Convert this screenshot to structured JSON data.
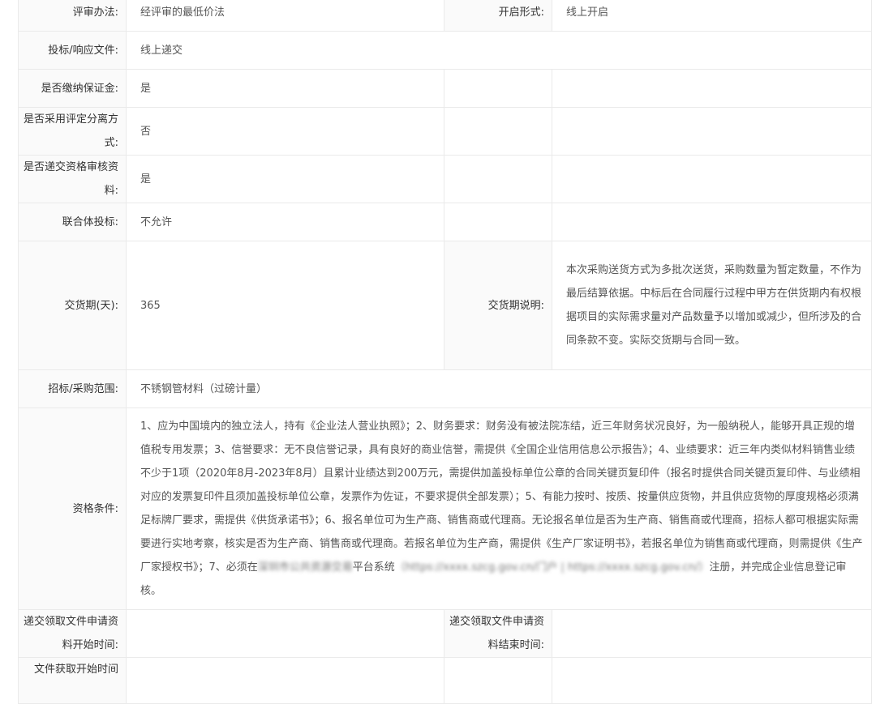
{
  "rows": {
    "eval_method": {
      "label": "评审办法:",
      "value": "经评审的最低价法"
    },
    "open_form": {
      "label": "开启形式:",
      "value": "线上开启"
    },
    "bid_doc": {
      "label": "投标/响应文件:",
      "value": "线上递交"
    },
    "deposit": {
      "label": "是否缴纳保证金:",
      "value": "是"
    },
    "separate": {
      "label": "是否采用评定分离方式:",
      "value": "否"
    },
    "qualify_docs": {
      "label": "是否递交资格审核资料:",
      "value": "是"
    },
    "consortium": {
      "label": "联合体投标:",
      "value": "不允许"
    },
    "delivery_days": {
      "label": "交货期(天):",
      "value": "365"
    },
    "delivery_note": {
      "label": "交货期说明:",
      "value": "本次采购送货方式为多批次送货，采购数量为暂定数量，不作为最后结算依据。中标后在合同履行过程中甲方在供货期内有权根据项目的实际需求量对产品数量予以增加或减少，但所涉及的合同条款不变。实际交货期与合同一致。"
    },
    "scope": {
      "label": "招标/采购范围:",
      "value": "不锈钢管材料（过磅计量）"
    },
    "qualification": {
      "label": "资格条件:",
      "text_a": "1、应为中国境内的独立法人，持有《企业法人营业执照》；2、财务要求：财务没有被法院冻结，近三年财务状况良好，为一般纳税人，能够开具正规的增值税专用发票；3、信誉要求：无不良信誉记录，具有良好的商业信誉，需提供《全国企业信用信息公示报告》；4、业绩要求：近三年内类似材料销售业绩不少于1项（2020年8月-2023年8月）且累计业绩达到200万元，需提供加盖投标单位公章的合同关键页复印件（报名时提供合同关键页复印件、与业绩相对应的发票复印件且须加盖投标单位公章，发票作为佐证，不要求提供全部发票）；5、有能力按时、按质、按量供应货物，并且供应货物的厚度规格必须满足标牌厂要求，需提供《供货承诺书》；6、报名单位可为生产商、销售商或代理商。无论报名单位是否为生产商、销售商或代理商，招标人都可根据实际需要进行实地考察，核实是否为生产商、销售商或代理商。若报名单位为生产商，需提供《生产厂家证明书》，若报名单位为销售商或代理商，则需提供《生产厂家授权书》；7、必须在",
      "blur_a": "深圳市公共资源交易",
      "text_b": "平台系统",
      "blur_b": "（https://xxxx.szcg.gov.cn/门户 | https://xxxx.szcg.gov.cn/）",
      "text_c": "注册，并完成企业信息登记审核。"
    },
    "apply_start": {
      "label": "递交领取文件申请资料开始时间:",
      "value": ""
    },
    "apply_end": {
      "label": "递交领取文件申请资料结束时间:",
      "value": ""
    },
    "doc_start": {
      "label": "文件获取开始时间",
      "value": ""
    }
  }
}
